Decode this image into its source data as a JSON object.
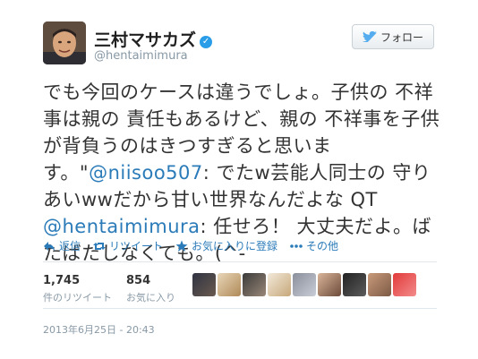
{
  "user": {
    "name": "三村マサカズ",
    "handle": "@hentaimimura",
    "follow_label": "フォロー"
  },
  "tweet": {
    "seg1": "でも今回のケースは違うでしょ。子供の 不祥事は親の 責任もあるけど、親の 不祥事を子供が背負うのはきつすぎると思います。\"",
    "mention1": "@niisoo507",
    "seg2": ": でたw芸能人同士の 守りあいwwだから甘い世界なんだよな QT ",
    "mention2": "@hentaimimura",
    "seg3": ": 任せろ！ 大丈夫だよ。ばたばたしなくても。(^-"
  },
  "actions": {
    "reply": "返信",
    "retweet": "リツイート",
    "favorite": "お気に入りに登録",
    "more": "その他"
  },
  "stats": {
    "retweets_count": "1,745",
    "retweets_label": "件のリツイート",
    "favorites_count": "854",
    "favorites_label": "お気に入り"
  },
  "timestamp": "2013年6月25日 - 20:43",
  "colors": {
    "link": "#2b7bb9",
    "verified": "#2a9de8"
  }
}
